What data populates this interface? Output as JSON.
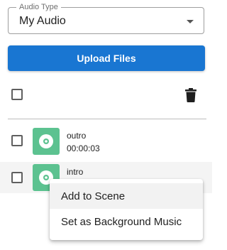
{
  "audio_type": {
    "label": "Audio Type",
    "value": "My Audio"
  },
  "upload_button": {
    "label": "Upload Files"
  },
  "icons": {
    "delete": "trash-icon",
    "audio_thumb": "disc-icon",
    "dropdown": "caret-down-icon"
  },
  "items": [
    {
      "name": "outro",
      "duration": "00:00:03"
    },
    {
      "name": "intro"
    }
  ],
  "context_menu": {
    "items": [
      {
        "label": "Add to Scene"
      },
      {
        "label": "Set as Background Music"
      }
    ]
  },
  "colors": {
    "primary": "#1976d2",
    "thumb": "#5cc290"
  }
}
